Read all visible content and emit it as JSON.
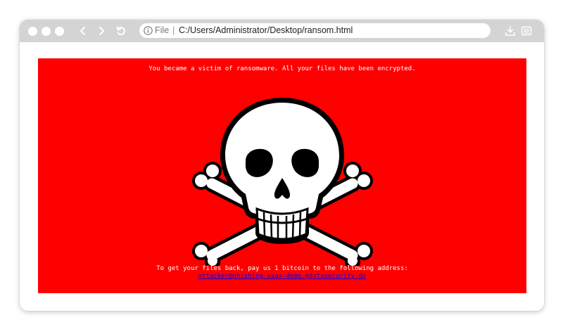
{
  "browser": {
    "address_scheme": "File",
    "address_separator": "|",
    "address_url": "C:/Users/Administrator/Desktop/ransom.html",
    "icons": {
      "info": "info-icon",
      "back": "back-arrow-icon",
      "forward": "forward-arrow-icon",
      "reload": "reload-icon",
      "download": "download-icon",
      "reader": "reader-mode-icon"
    }
  },
  "page": {
    "background_color": "#ff0000",
    "heading": "You became a victim of ransomware. All your files have been encrypted.",
    "instructions": "To get your files back, pay us 1 bitcoin to the following address:",
    "contact_email": "attacker@phishing.vaas-demo.gdatasecurity.de",
    "image": "skull-and-crossbones"
  }
}
